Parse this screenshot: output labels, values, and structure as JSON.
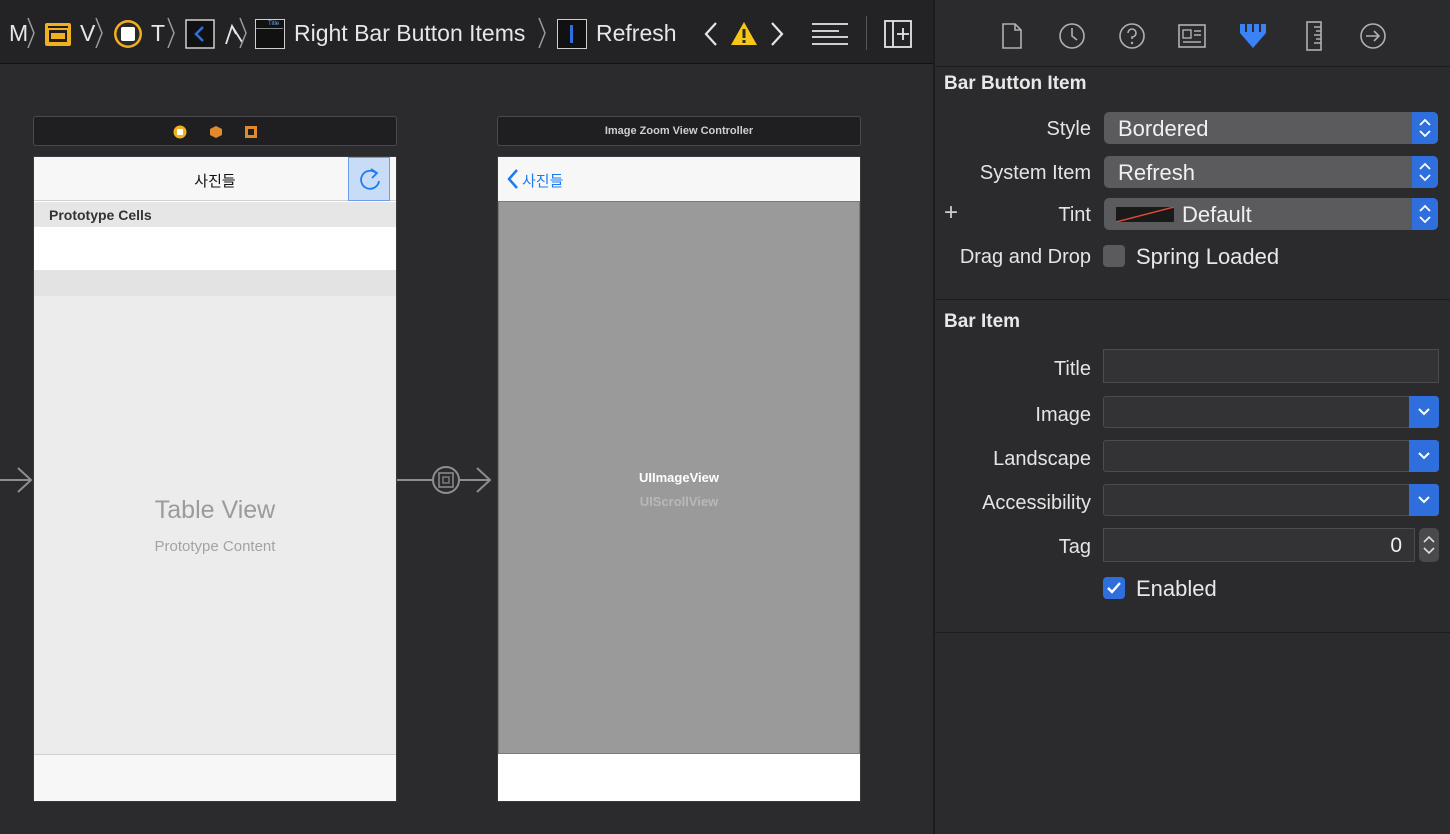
{
  "jumpbar": {
    "items": [
      "M",
      "V",
      "T",
      "Right Bar Button Items",
      "Refresh"
    ],
    "title_icon_text": "Title"
  },
  "canvas": {
    "scene1": {
      "nav_title": "사진들",
      "section_header": "Prototype Cells",
      "table_title": "Table View",
      "table_subtitle": "Prototype Content"
    },
    "scene2": {
      "bar_title": "Image Zoom View Controller",
      "back_label": "사진들",
      "image_view_label": "UIImageView",
      "scroll_view_label": "UIScrollView"
    }
  },
  "inspector": {
    "bar_button_item": {
      "title": "Bar Button Item",
      "style_label": "Style",
      "style_value": "Bordered",
      "system_item_label": "System Item",
      "system_item_value": "Refresh",
      "tint_label": "Tint",
      "tint_value": "Default",
      "drag_drop_label": "Drag and Drop",
      "spring_loaded_label": "Spring Loaded",
      "plus": "+"
    },
    "bar_item": {
      "title": "Bar Item",
      "title_label": "Title",
      "title_value": "",
      "image_label": "Image",
      "landscape_label": "Landscape",
      "accessibility_label": "Accessibility",
      "tag_label": "Tag",
      "tag_value": "0",
      "enabled_label": "Enabled",
      "enabled_checked": true
    }
  },
  "colors": {
    "accent": "#2f6fdd",
    "ios_blue": "#1a7cf5",
    "warning": "#f5c518",
    "selected_inspector_tab": "#3b82f6"
  }
}
